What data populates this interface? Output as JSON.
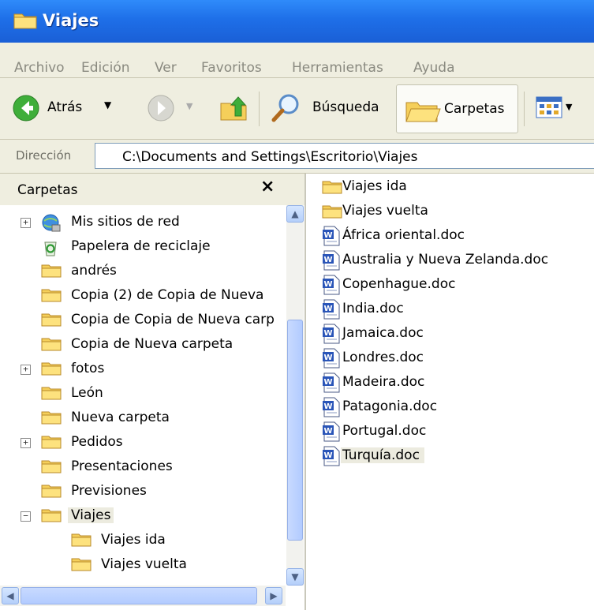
{
  "window": {
    "title": "Viajes"
  },
  "menu": [
    "Archivo",
    "Edición",
    "Ver",
    "Favoritos",
    "Herramientas",
    "Ayuda"
  ],
  "toolbar": {
    "back_label": "Atrás",
    "search_label": "Búsqueda",
    "folders_label": "Carpetas"
  },
  "address": {
    "label": "Dirección",
    "value": "C:\\Documents and Settings\\Escritorio\\Viajes"
  },
  "folders_pane": {
    "title": "Carpetas",
    "close_symbol": "×",
    "items": [
      {
        "label": "Mis sitios de red",
        "expander": "+"
      },
      {
        "label": "Papelera de reciclaje",
        "expander": ""
      },
      {
        "label": "andrés",
        "expander": ""
      },
      {
        "label": "Copia (2) de Copia de Nueva",
        "expander": ""
      },
      {
        "label": "Copia de Copia de Nueva carp",
        "expander": ""
      },
      {
        "label": "Copia de Nueva carpeta",
        "expander": ""
      },
      {
        "label": "fotos",
        "expander": "+"
      },
      {
        "label": "León",
        "expander": ""
      },
      {
        "label": "Nueva carpeta",
        "expander": ""
      },
      {
        "label": "Pedidos",
        "expander": "+"
      },
      {
        "label": "Presentaciones",
        "expander": ""
      },
      {
        "label": "Previsiones",
        "expander": ""
      },
      {
        "label": "Viajes",
        "expander": "−",
        "selected": true
      },
      {
        "label": "Viajes ida",
        "expander": "",
        "child": true
      },
      {
        "label": "Viajes vuelta",
        "expander": "",
        "child": true
      }
    ]
  },
  "files_pane": {
    "items": [
      {
        "label": "Viajes ida",
        "type": "folder"
      },
      {
        "label": "Viajes vuelta",
        "type": "folder"
      },
      {
        "label": "África oriental.doc",
        "type": "doc"
      },
      {
        "label": "Australia y Nueva Zelanda.doc",
        "type": "doc"
      },
      {
        "label": "Copenhague.doc",
        "type": "doc"
      },
      {
        "label": "India.doc",
        "type": "doc"
      },
      {
        "label": "Jamaica.doc",
        "type": "doc"
      },
      {
        "label": "Londres.doc",
        "type": "doc"
      },
      {
        "label": "Madeira.doc",
        "type": "doc"
      },
      {
        "label": "Patagonia.doc",
        "type": "doc"
      },
      {
        "label": "Portugal.doc",
        "type": "doc"
      },
      {
        "label": "Turquía.doc",
        "type": "doc",
        "selected": true
      }
    ]
  },
  "colors": {
    "titlebar": "#1e6fe8",
    "chrome": "#efeee0",
    "folder": "#f5cf5a",
    "selection": "#ecebdf"
  }
}
